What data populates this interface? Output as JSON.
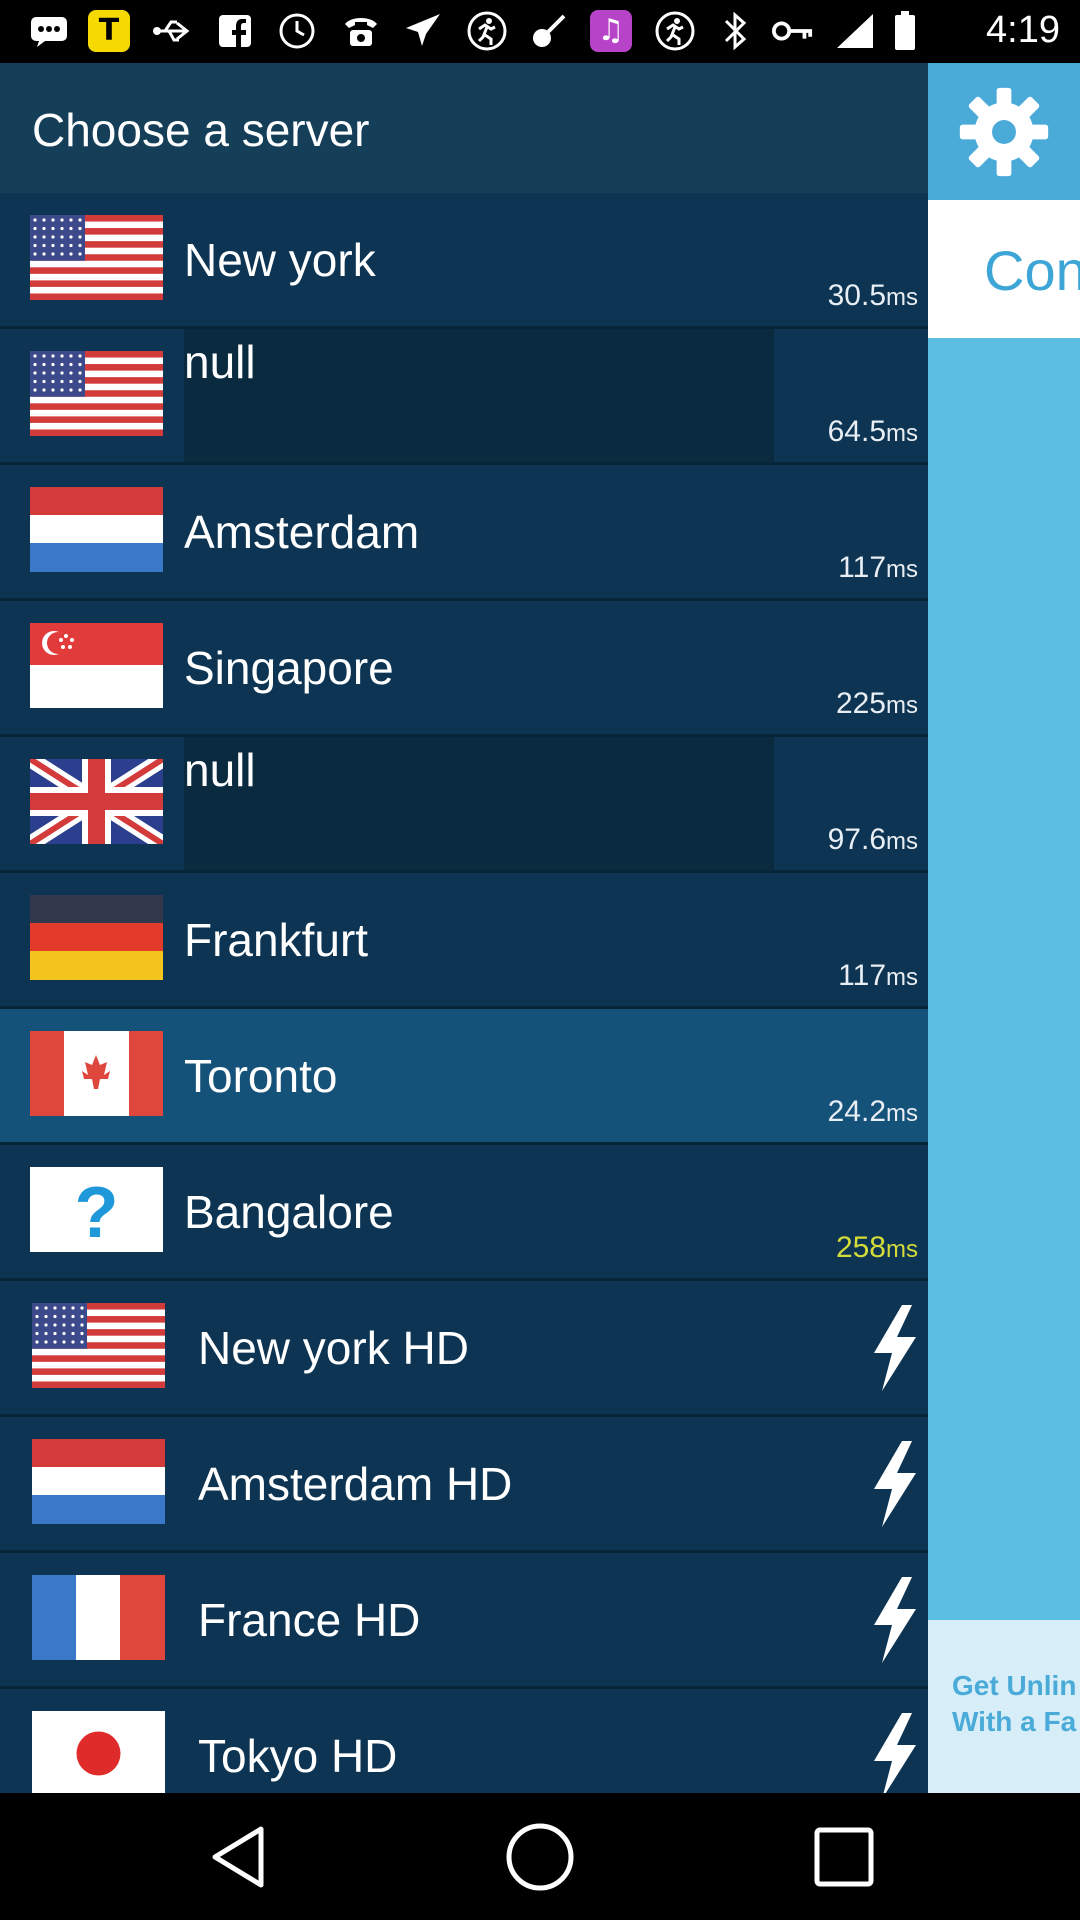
{
  "status_bar": {
    "time": "4:19",
    "icons": [
      "message-icon",
      "tt-app-icon",
      "usb-icon",
      "facebook-icon",
      "clock-icon",
      "phone-icon",
      "airplane-icon",
      "runner-icon",
      "guitar-icon",
      "music-icon",
      "runner-icon",
      "bluetooth-icon",
      "key-icon",
      "signal-icon",
      "battery-icon"
    ]
  },
  "drawer": {
    "title": "Choose a server",
    "servers": [
      {
        "name": "New york",
        "flag": "us",
        "ping": "30.5",
        "unit": "ms"
      },
      {
        "name": "null",
        "flag": "us",
        "ping": "64.5",
        "unit": "ms"
      },
      {
        "name": "Amsterdam",
        "flag": "nl",
        "ping": "117",
        "unit": "ms"
      },
      {
        "name": "Singapore",
        "flag": "sg",
        "ping": "225",
        "unit": "ms"
      },
      {
        "name": "null",
        "flag": "gb",
        "ping": "97.6",
        "unit": "ms"
      },
      {
        "name": "Frankfurt",
        "flag": "de",
        "ping": "117",
        "unit": "ms"
      },
      {
        "name": "Toronto",
        "flag": "ca",
        "ping": "24.2",
        "unit": "ms"
      },
      {
        "name": "Bangalore",
        "flag": "unknown",
        "ping": "258",
        "unit": "ms"
      }
    ],
    "hd_servers": [
      {
        "name": "New york HD",
        "flag": "us"
      },
      {
        "name": "Amsterdam HD",
        "flag": "nl"
      },
      {
        "name": "France HD",
        "flag": "fr"
      },
      {
        "name": "Tokyo HD",
        "flag": "jp"
      }
    ]
  },
  "right_panel": {
    "connect_label": "Con",
    "promo_line1": "Get Unlin",
    "promo_line2": "With a Fa"
  },
  "colors": {
    "drawer_bg": "#0c3550",
    "selected_row": "#15527a",
    "accent_blue": "#5bbfe3",
    "slow_ping": "#d4dc3a"
  }
}
